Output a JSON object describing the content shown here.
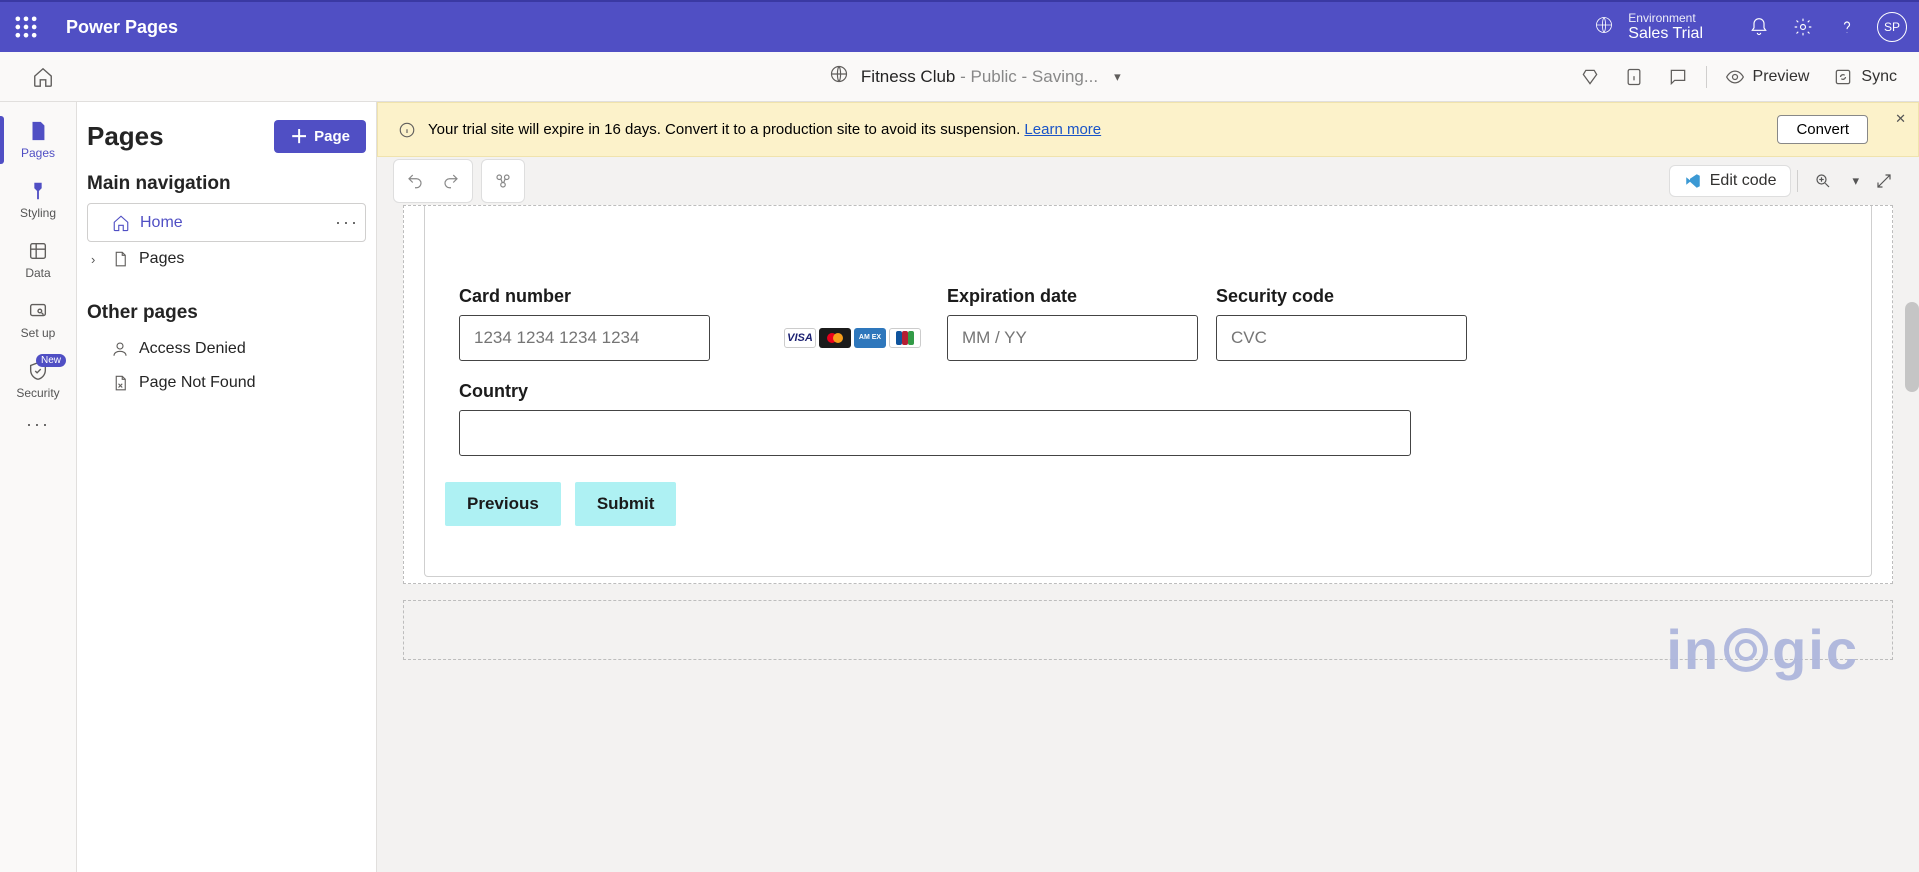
{
  "header": {
    "brand": "Power Pages",
    "environment_label": "Environment",
    "environment_name": "Sales Trial",
    "avatar_initials": "SP"
  },
  "subheader": {
    "site_name": "Fitness Club",
    "site_status": " - Public - Saving...",
    "preview_label": "Preview",
    "sync_label": "Sync"
  },
  "rail": {
    "pages": "Pages",
    "styling": "Styling",
    "data": "Data",
    "setup": "Set up",
    "security": "Security",
    "security_badge": "New"
  },
  "side_panel": {
    "title": "Pages",
    "add_button": "Page",
    "section_main": "Main navigation",
    "home_label": "Home",
    "pages_label": "Pages",
    "section_other": "Other pages",
    "access_denied": "Access Denied",
    "not_found": "Page Not Found"
  },
  "banner": {
    "text": "Your trial site will expire in 16 days. Convert it to a production site to avoid its suspension. ",
    "link": "Learn more",
    "convert": "Convert"
  },
  "toolbar": {
    "edit_code": "Edit code"
  },
  "form": {
    "card_label": "Card number",
    "card_placeholder": "1234 1234 1234 1234",
    "exp_label": "Expiration date",
    "exp_placeholder": "MM / YY",
    "cvc_label": "Security code",
    "cvc_placeholder": "CVC",
    "country_label": "Country",
    "prev_btn": "Previous",
    "submit_btn": "Submit",
    "visa": "VISA",
    "amex": "AM EX"
  },
  "watermark": {
    "p1": "in",
    "p2": "gic"
  }
}
